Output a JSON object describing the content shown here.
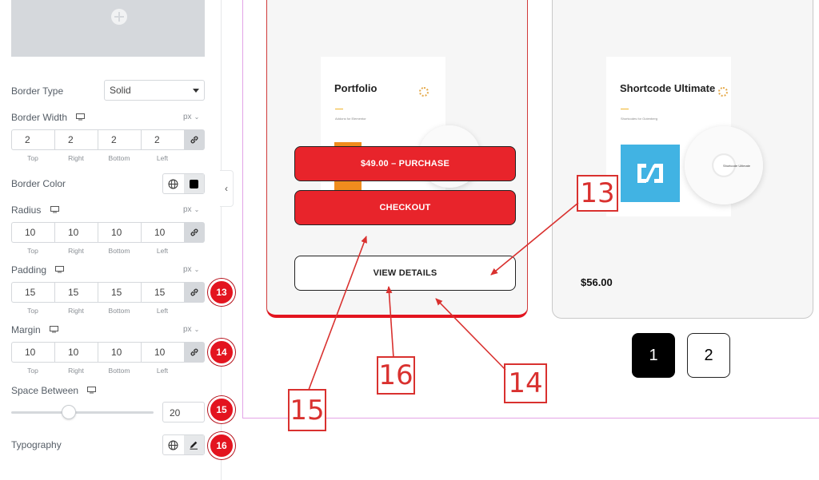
{
  "panel": {
    "border_type": {
      "label": "Border Type",
      "value": "Solid"
    },
    "border_width": {
      "label": "Border Width",
      "unit": "px",
      "values": [
        "2",
        "2",
        "2",
        "2"
      ]
    },
    "border_color": {
      "label": "Border Color",
      "color": "#000000"
    },
    "radius": {
      "label": "Radius",
      "unit": "px",
      "values": [
        "10",
        "10",
        "10",
        "10"
      ]
    },
    "padding": {
      "label": "Padding",
      "unit": "px",
      "values": [
        "15",
        "15",
        "15",
        "15"
      ],
      "badge": "13"
    },
    "margin": {
      "label": "Margin",
      "unit": "px",
      "values": [
        "10",
        "10",
        "10",
        "10"
      ],
      "badge": "14"
    },
    "space_between": {
      "label": "Space Between",
      "value": "20",
      "badge": "15",
      "level": 0.35
    },
    "typography": {
      "label": "Typography",
      "badge": "16"
    },
    "dim_labels": [
      "Top",
      "Right",
      "Bottom",
      "Left"
    ]
  },
  "products": [
    {
      "title": "Portfolio",
      "subtitle": "Addons for Elementor",
      "purchase_label": "$49.00 – PURCHASE",
      "checkout_label": "CHECKOUT",
      "details_label": "VIEW DETAILS"
    },
    {
      "title": "Shortcode Ultimate",
      "subtitle": "Shortcodes for Gutenberg",
      "disc_label": "Shortcode Ultimate",
      "price": "$56.00"
    }
  ],
  "pagination": {
    "pages": [
      "1",
      "2"
    ],
    "active": "1"
  },
  "callouts": [
    "13",
    "14",
    "15",
    "16"
  ],
  "colors": {
    "accent_red": "#e8242b",
    "badge_red": "#e3141f",
    "callout_red": "#d9312f",
    "canvas_border": "#e3a4e6"
  }
}
